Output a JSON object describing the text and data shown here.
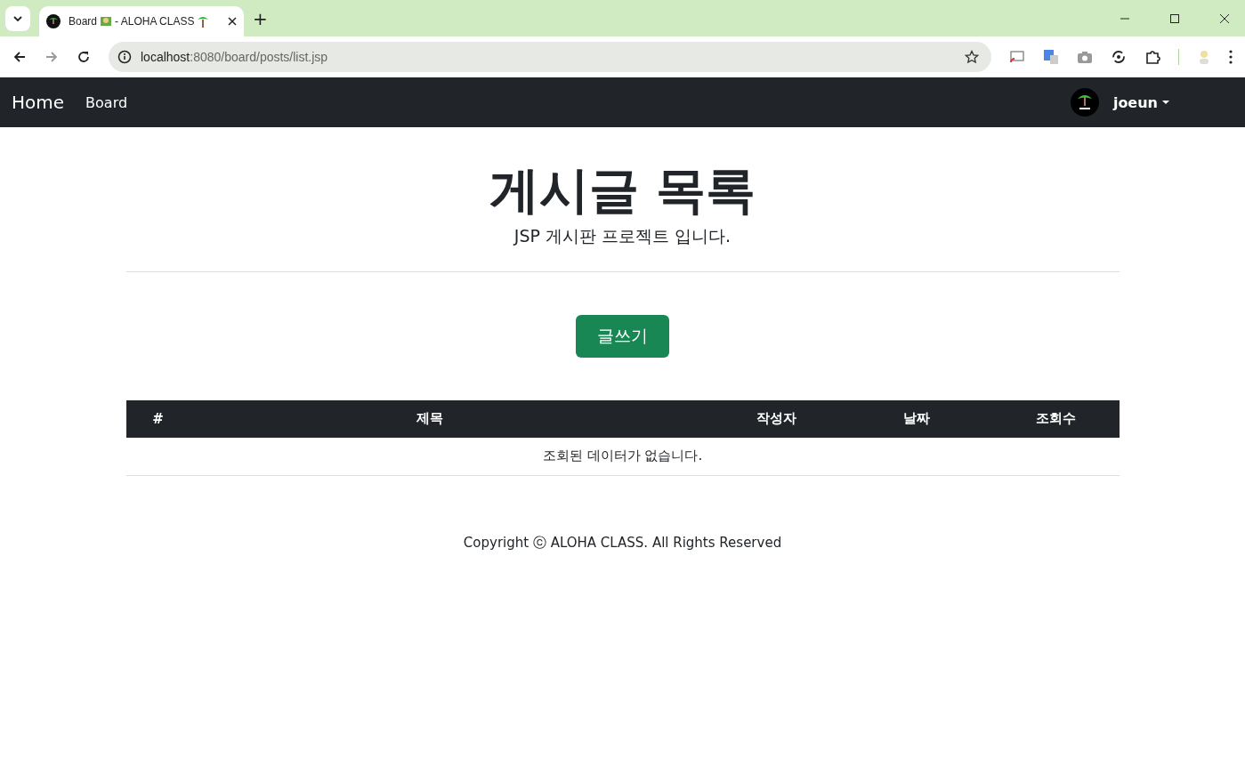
{
  "browser": {
    "tab_title_start": "Board",
    "tab_title_end": "- ALOHA CLASS",
    "new_tab": "+",
    "url_host": "localhost",
    "url_rest": ":8080/board/posts/list.jsp"
  },
  "navbar": {
    "brand": "Home",
    "links": [
      "Board"
    ],
    "user": "joeun"
  },
  "header": {
    "title": "게시글 목록",
    "subtitle": "JSP 게시판 프로젝트 입니다."
  },
  "write_button": "글쓰기",
  "table": {
    "columns": [
      "#",
      "제목",
      "작성자",
      "날짜",
      "조회수"
    ],
    "empty_message": "조회된 데이터가 없습니다."
  },
  "footer": "Copyright ⓒ ALOHA CLASS. All Rights Reserved"
}
